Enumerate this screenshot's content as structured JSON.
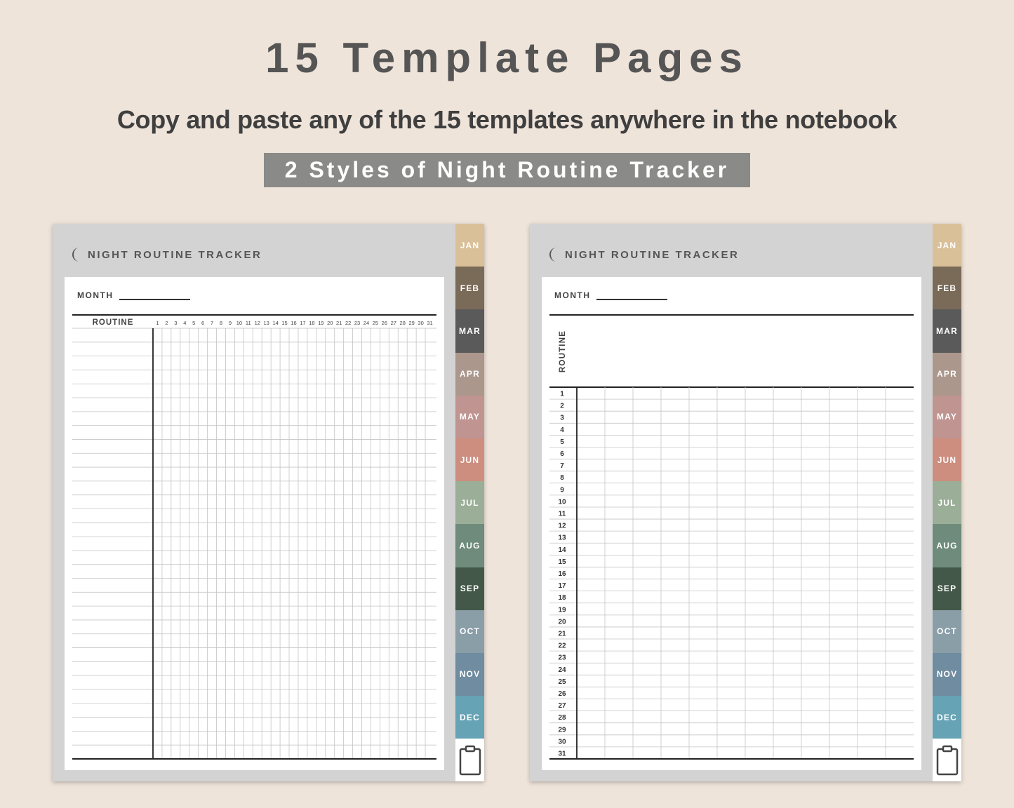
{
  "header": {
    "title": "15 Template Pages",
    "subtitle": "Copy and paste any of the 15 templates anywhere in the notebook",
    "banner": "2 Styles of Night Routine Tracker"
  },
  "page_title": "NIGHT ROUTINE TRACKER",
  "month_label": "MONTH",
  "routine_label": "ROUTINE",
  "day_numbers": [
    "1",
    "2",
    "3",
    "4",
    "5",
    "6",
    "7",
    "8",
    "9",
    "10",
    "11",
    "12",
    "13",
    "14",
    "15",
    "16",
    "17",
    "18",
    "19",
    "20",
    "21",
    "22",
    "23",
    "24",
    "25",
    "26",
    "27",
    "28",
    "29",
    "30",
    "31"
  ],
  "month_tabs": [
    {
      "label": "JAN",
      "color": "#d9c098"
    },
    {
      "label": "FEB",
      "color": "#7a6a58"
    },
    {
      "label": "MAR",
      "color": "#5a5a5a"
    },
    {
      "label": "APR",
      "color": "#ab978c"
    },
    {
      "label": "MAY",
      "color": "#bf9491"
    },
    {
      "label": "JUN",
      "color": "#cd8d7f"
    },
    {
      "label": "JUL",
      "color": "#9bae98"
    },
    {
      "label": "AUG",
      "color": "#6e8b7b"
    },
    {
      "label": "SEP",
      "color": "#435848"
    },
    {
      "label": "OCT",
      "color": "#8a9ea8"
    },
    {
      "label": "NOV",
      "color": "#6f8ca0"
    },
    {
      "label": "DEC",
      "color": "#66a3b5"
    }
  ],
  "icons": {
    "moon": "moon-icon",
    "notes": "clipboard-icon"
  }
}
